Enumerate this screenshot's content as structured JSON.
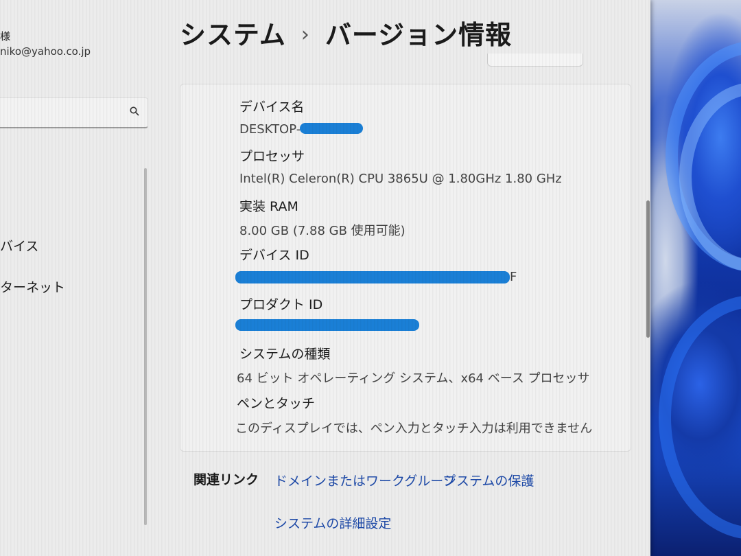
{
  "account": {
    "name": "様",
    "email": "niko@yahoo.co.jp"
  },
  "search": {
    "icon": "search-icon"
  },
  "sidebar": {
    "items": [
      {
        "label": "バイス"
      },
      {
        "label": "ターネット"
      }
    ]
  },
  "header": {
    "breadcrumb_parent": "システム",
    "separator": "›",
    "title": "バージョン情報"
  },
  "specs": {
    "device_name_label": "デバイス名",
    "device_name_value": "DESKTOP-",
    "processor_label": "プロセッサ",
    "processor_value": "Intel(R) Celeron(R) CPU 3865U @ 1.80GHz   1.80 GHz",
    "ram_label": "実装 RAM",
    "ram_value": "8.00 GB (7.88 GB 使用可能)",
    "device_id_label": "デバイス ID",
    "device_id_value": "F",
    "product_id_label": "プロダクト ID",
    "system_type_label": "システムの種類",
    "system_type_value": "64 ビット オペレーティング システム、x64 ベース プロセッサ",
    "pen_touch_label": "ペンとタッチ",
    "pen_touch_value": "このディスプレイでは、ペン入力とタッチ入力は利用できません"
  },
  "related": {
    "label": "関連リンク",
    "links": [
      {
        "label": "ドメインまたはワークグループ"
      },
      {
        "label": "システムの保護"
      },
      {
        "label": "システムの詳細設定"
      }
    ]
  },
  "colors": {
    "link": "#1e4aa8",
    "redaction": "#1a7fd6",
    "wallpaper_accent": "#1848c8"
  }
}
